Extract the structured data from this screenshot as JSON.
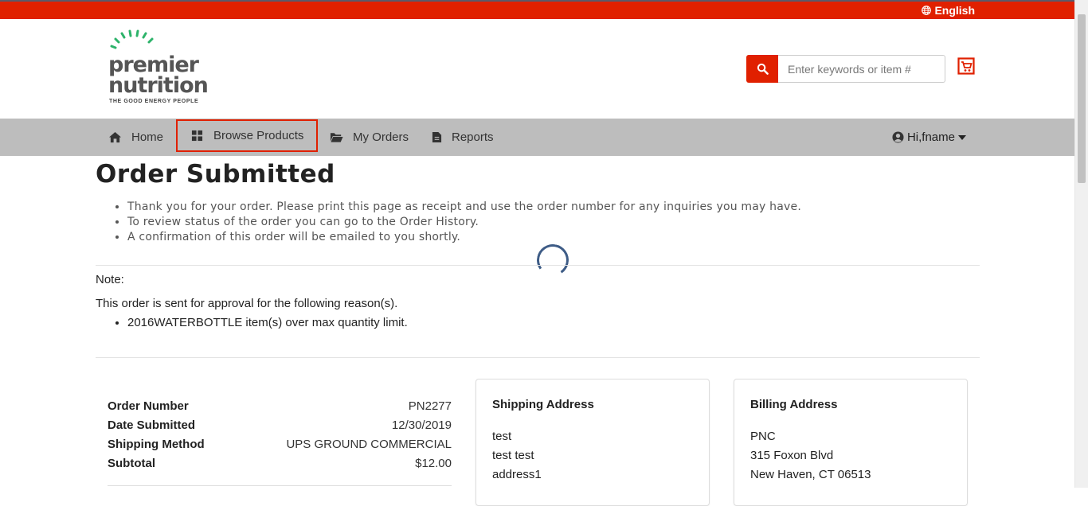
{
  "topbar": {
    "language": "English"
  },
  "logo": {
    "word1": "premier",
    "word2": "nutrition",
    "tagline": "THE GOOD ENERGY PEOPLE"
  },
  "search": {
    "placeholder": "Enter keywords or item #"
  },
  "nav": {
    "items": [
      {
        "label": "Home",
        "icon": "home-icon"
      },
      {
        "label": "Browse Products",
        "icon": "grid-icon"
      },
      {
        "label": "My Orders",
        "icon": "folder-icon"
      },
      {
        "label": "Reports",
        "icon": "document-icon"
      }
    ],
    "user": "Hi,fname"
  },
  "page": {
    "title": "Order Submitted",
    "intro": [
      "Thank you for your order. Please print this page as receipt and use the order number for any inquiries you may have.",
      "To review status of the order you can go to the Order History.",
      "A confirmation of this order will be emailed to you shortly."
    ],
    "note_label": "Note:",
    "note_text": "This order is sent for approval for the following reason(s).",
    "reasons": [
      "2016WATERBOTTLE item(s) over max quantity limit."
    ]
  },
  "summary": {
    "rows": [
      {
        "label": "Order Number",
        "value": "PN2277"
      },
      {
        "label": "Date Submitted",
        "value": "12/30/2019"
      },
      {
        "label": "Shipping Method",
        "value": "UPS GROUND COMMERCIAL"
      },
      {
        "label": "Subtotal",
        "value": "$12.00"
      }
    ]
  },
  "shipping": {
    "heading": "Shipping Address",
    "lines": [
      "test",
      "test test",
      "address1"
    ]
  },
  "billing": {
    "heading": "Billing Address",
    "lines": [
      "PNC",
      "315 Foxon Blvd",
      "New Haven, CT 06513"
    ]
  },
  "colors": {
    "brand_red": "#e02000",
    "nav_bg": "#bdbdbd",
    "logo_green": "#2db36a",
    "spinner": "#3e5c86"
  }
}
